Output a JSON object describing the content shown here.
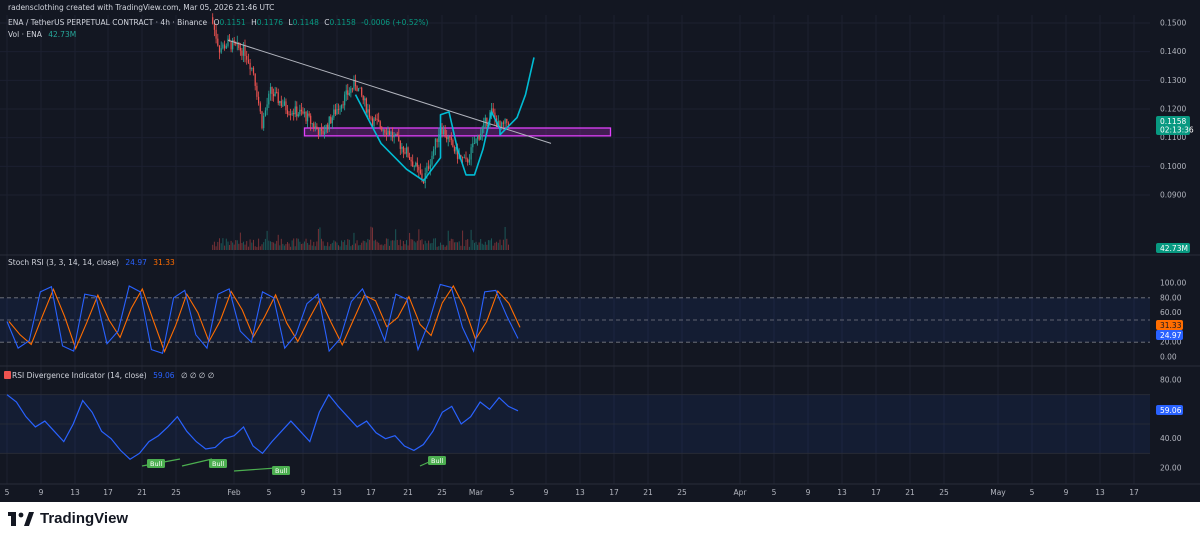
{
  "header": {
    "attribution": "radensclothing created with TradingView.com, Mar 05, 2026 21:46 UTC",
    "symbol": "ENA / TetherUS PERPETUAL CONTRACT · 4h · Binance",
    "ohlc": {
      "o_label": "O",
      "o": "0.1151",
      "h_label": "H",
      "h": "0.1176",
      "l_label": "L",
      "l": "0.1148",
      "c_label": "C",
      "c": "0.1158",
      "change": "-0.0006 (+0.52%)"
    },
    "volume_label": "Vol · ENA",
    "volume_value": "42.73M"
  },
  "price_axis": {
    "ticks": [
      "0.1500",
      "0.1400",
      "0.1300",
      "0.1200",
      "0.1100",
      "0.1000",
      "0.0900"
    ],
    "last_price_tag": "0.1158",
    "countdown": "02:13:36",
    "volume_tag": "42.73M"
  },
  "stoch_rsi": {
    "label": "Stoch RSI (3, 3, 14, 14, close)",
    "k_value": "24.97",
    "d_value": "31.33",
    "ticks": [
      "100.00",
      "80.00",
      "60.00",
      "40.00",
      "20.00",
      "0.00"
    ]
  },
  "rsi_div": {
    "label": "RSI Divergence Indicator (14, close)",
    "value": "59.06",
    "extra": "∅ ∅ ∅ ∅",
    "ticks": [
      "80.00",
      "60.00",
      "40.00",
      "20.00"
    ],
    "bull_labels": [
      "Bull",
      "Bull",
      "Bull",
      "Bull"
    ]
  },
  "time_axis": [
    "5",
    "9",
    "13",
    "17",
    "21",
    "25",
    "Feb",
    "5",
    "9",
    "13",
    "17",
    "21",
    "25",
    "Mar",
    "5",
    "9",
    "13",
    "17",
    "21",
    "25",
    "Apr",
    "5",
    "9",
    "13",
    "17",
    "21",
    "25",
    "May",
    "5",
    "9",
    "13",
    "17"
  ],
  "brand": {
    "name": "TradingView"
  },
  "colors": {
    "background": "#131722",
    "candle_up": "#26a69a",
    "candle_down": "#ef5350",
    "trendline": "#b2b5be",
    "zone": "#9c27b0",
    "projection": "#00bcd4",
    "stoch_k": "#2962ff",
    "stoch_d": "#ff6d00",
    "rsi_line": "#2962ff",
    "bull_label": "#4caf50",
    "price_tag": "#089981"
  },
  "chart_data": [
    {
      "type": "candlestick",
      "timeframe": "4h",
      "y_range": [
        0.083,
        0.153
      ],
      "x_date_range": [
        "Jan 29",
        "Mar 06"
      ],
      "path_points": [
        {
          "x": "Jan 29",
          "y": 0.152
        },
        {
          "x": "Jan 30",
          "y": 0.141
        },
        {
          "x": "Jan 31",
          "y": 0.143
        },
        {
          "x": "Feb 02",
          "y": 0.14
        },
        {
          "x": "Feb 03",
          "y": 0.133
        },
        {
          "x": "Feb 04",
          "y": 0.115
        },
        {
          "x": "Feb 05",
          "y": 0.126
        },
        {
          "x": "Feb 07",
          "y": 0.12
        },
        {
          "x": "Feb 09",
          "y": 0.118
        },
        {
          "x": "Feb 11",
          "y": 0.111
        },
        {
          "x": "Feb 13",
          "y": 0.121
        },
        {
          "x": "Feb 15",
          "y": 0.129
        },
        {
          "x": "Feb 17",
          "y": 0.116
        },
        {
          "x": "Feb 19",
          "y": 0.112
        },
        {
          "x": "Feb 21",
          "y": 0.105
        },
        {
          "x": "Feb 23",
          "y": 0.095
        },
        {
          "x": "Feb 24",
          "y": 0.104
        },
        {
          "x": "Feb 25",
          "y": 0.114
        },
        {
          "x": "Feb 27",
          "y": 0.104
        },
        {
          "x": "Feb 28",
          "y": 0.101
        },
        {
          "x": "Mar 01",
          "y": 0.108
        },
        {
          "x": "Mar 03",
          "y": 0.119
        },
        {
          "x": "Mar 04",
          "y": 0.113
        },
        {
          "x": "Mar 05",
          "y": 0.1158
        }
      ],
      "annotations": {
        "trendline": {
          "from": {
            "x": "Jan 31",
            "y": 0.144
          },
          "to": {
            "x": "Mar 10",
            "y": 0.108
          }
        },
        "zone": {
          "x_from": "Feb 09",
          "x_to": "Mar 17",
          "y_low": 0.1115,
          "y_high": 0.1125
        },
        "projection_path": "cup and handle swings projecting toward 0.1380"
      }
    },
    {
      "type": "line",
      "title": "Stoch RSI (3, 3, 14, 14, close)",
      "y_range": [
        0,
        100
      ],
      "bands": [
        20,
        50,
        80
      ],
      "series": [
        {
          "name": "K",
          "last": 24.97
        },
        {
          "name": "D",
          "last": 31.33
        }
      ],
      "values": [
        48,
        12,
        22,
        88,
        95,
        15,
        8,
        85,
        82,
        18,
        35,
        96,
        88,
        10,
        5,
        80,
        90,
        30,
        12,
        85,
        92,
        35,
        20,
        88,
        80,
        12,
        30,
        72,
        85,
        8,
        25,
        75,
        92,
        60,
        22,
        85,
        78,
        10,
        48,
        98,
        94,
        40,
        8,
        88,
        90,
        55,
        25
      ]
    },
    {
      "type": "line",
      "title": "RSI Divergence Indicator (14, close)",
      "y_range": [
        15,
        90
      ],
      "bands": [
        30,
        50,
        70
      ],
      "series": [
        {
          "name": "RSI",
          "last": 59.06
        }
      ],
      "values": [
        70,
        65,
        55,
        48,
        52,
        45,
        38,
        50,
        66,
        58,
        45,
        40,
        32,
        26,
        30,
        38,
        42,
        48,
        55,
        45,
        38,
        33,
        34,
        40,
        42,
        48,
        35,
        30,
        38,
        45,
        52,
        45,
        38,
        58,
        70,
        62,
        55,
        48,
        52,
        44,
        40,
        42,
        35,
        32,
        36,
        45,
        58,
        62,
        50,
        55,
        65,
        60,
        68,
        62,
        59
      ]
    }
  ]
}
